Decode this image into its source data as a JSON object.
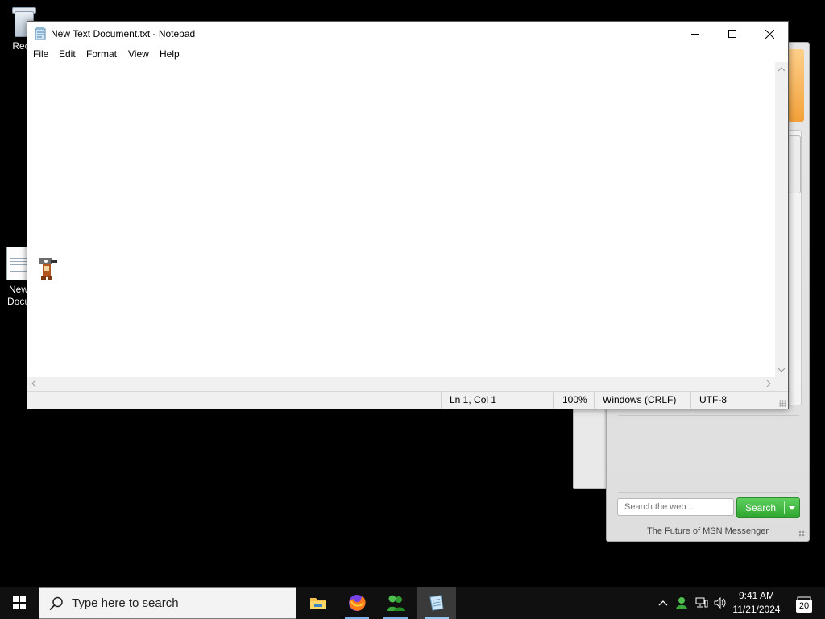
{
  "desktop": {
    "icons": [
      {
        "label": "Recy"
      },
      {
        "label": "New\nDocu"
      }
    ]
  },
  "notepad": {
    "title": "New Text Document.txt - Notepad",
    "menu": [
      "File",
      "Edit",
      "Format",
      "View",
      "Help"
    ],
    "content": "",
    "status": {
      "position": "Ln 1, Col 1",
      "zoom": "100%",
      "line_ending": "Windows (CRLF)",
      "encoding": "UTF-8"
    }
  },
  "msn": {
    "search_placeholder": "Search the web...",
    "search_button": "Search",
    "footer": "The Future of MSN Messenger",
    "accent": "#f3a13a",
    "button_color": "#2ea62e"
  },
  "taskbar": {
    "search_placeholder": "Type here to search",
    "apps": [
      "file-explorer-icon",
      "firefox-icon",
      "msn-messenger-icon",
      "notepad-icon"
    ],
    "clock_time": "9:41 AM",
    "clock_date": "11/21/2024",
    "notification_count": "20"
  }
}
